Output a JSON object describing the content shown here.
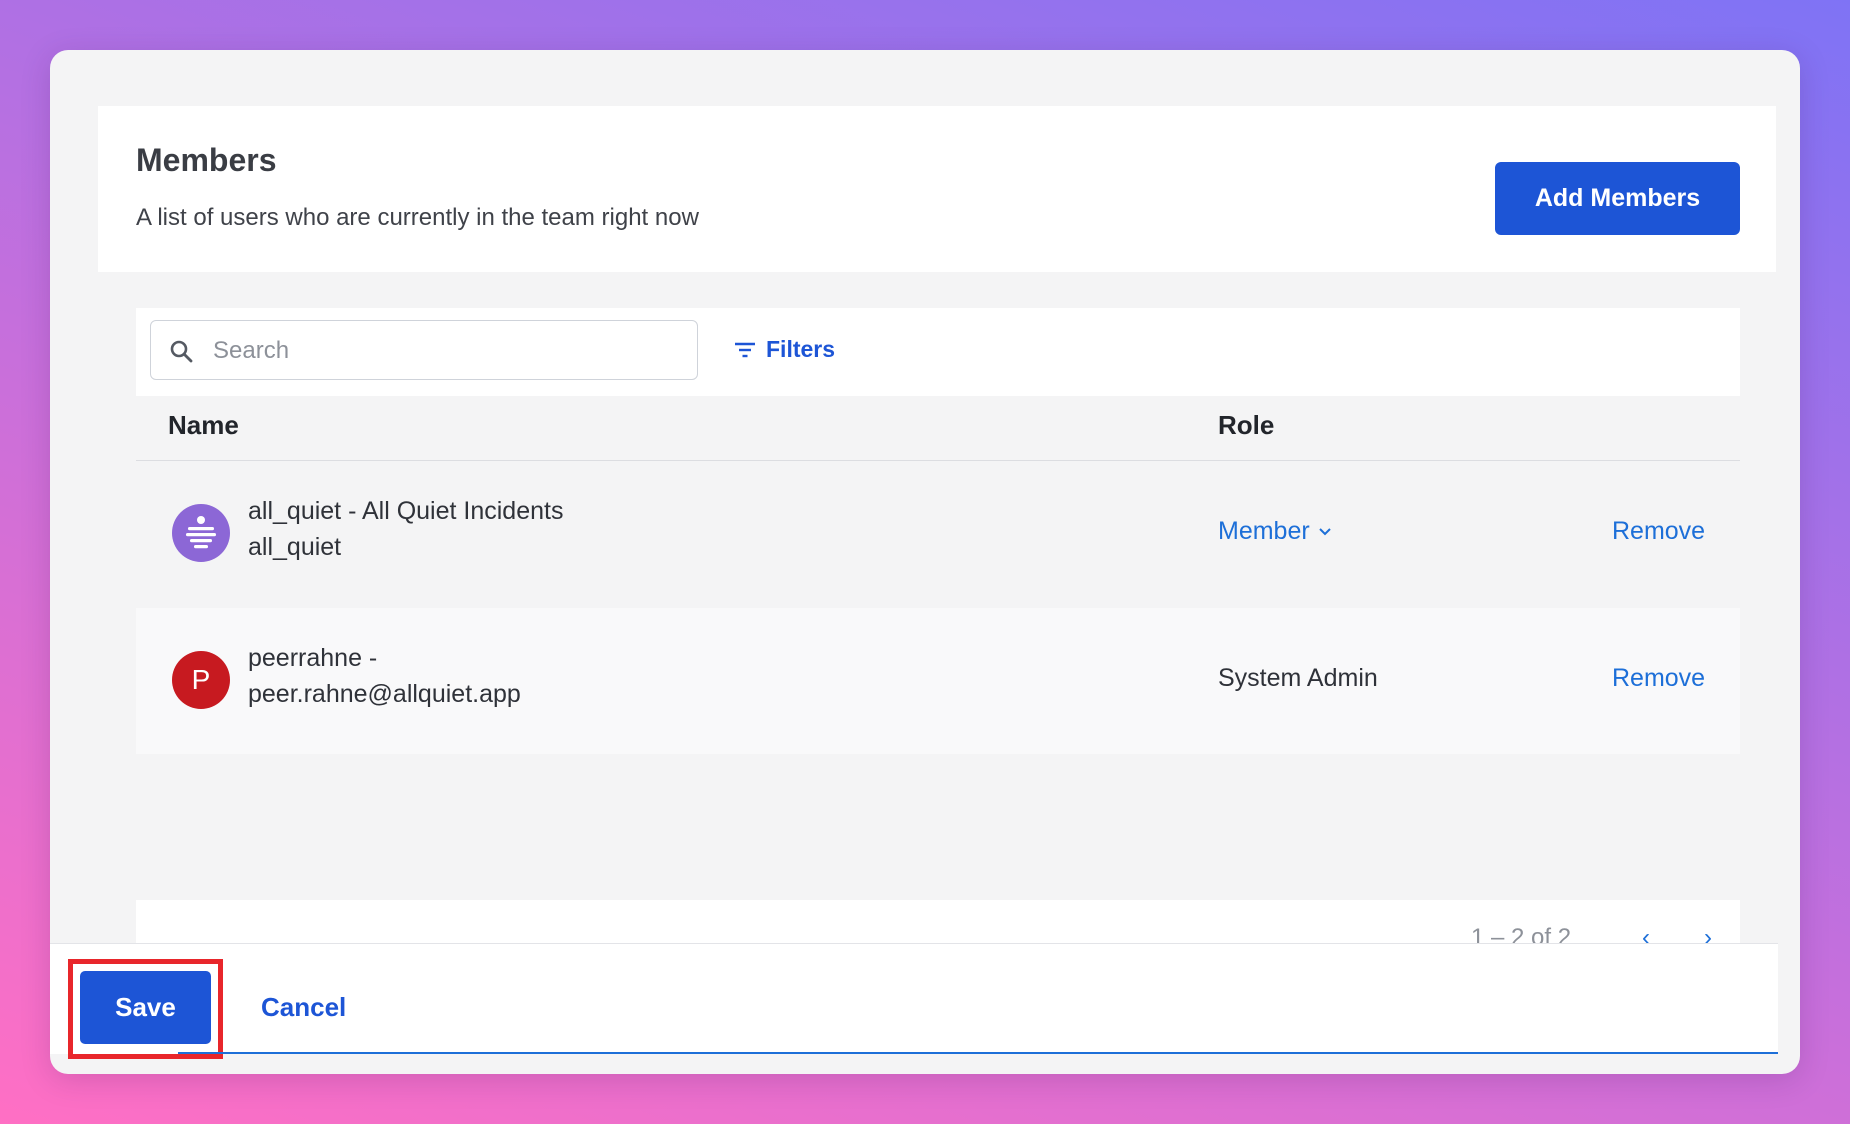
{
  "header": {
    "title": "Members",
    "subtitle": "A list of users who are currently in the team right now",
    "add_button": "Add Members"
  },
  "toolbar": {
    "search_placeholder": "Search",
    "filters_label": "Filters"
  },
  "table": {
    "columns": [
      "Name",
      "Role"
    ],
    "rows": [
      {
        "name_line1": "all_quiet - All Quiet Incidents",
        "name_line2": "all_quiet",
        "avatar": "all-quiet-logo-icon",
        "role": "Member",
        "role_editable": true,
        "action": "Remove"
      },
      {
        "name_line1": "peerrahne -",
        "name_line2": "peer.rahne@allquiet.app",
        "avatar_letter": "P",
        "role": "System Admin",
        "role_editable": false,
        "action": "Remove"
      }
    ]
  },
  "pagination": {
    "text": "1 – 2 of 2",
    "prev": "‹",
    "next": "›"
  },
  "footer": {
    "save_label": "Save",
    "cancel_label": "Cancel"
  },
  "colors": {
    "primary": "#1d55d6",
    "link": "#1d6fd8",
    "highlight": "#e8262b"
  }
}
